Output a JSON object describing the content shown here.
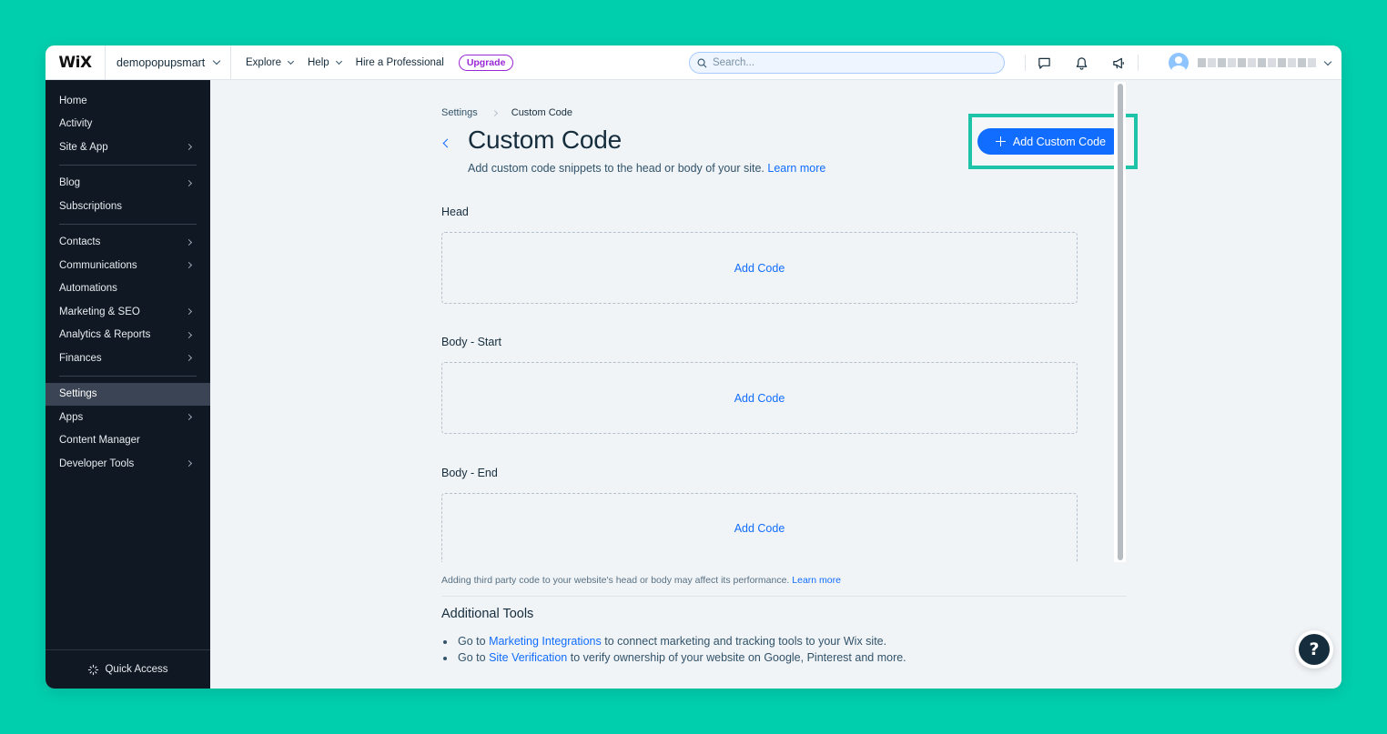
{
  "topbar": {
    "logo": "WiX",
    "site_name": "demopopupsmart",
    "nav": [
      {
        "label": "Explore"
      },
      {
        "label": "Help"
      },
      {
        "label": "Hire a Professional"
      }
    ],
    "upgrade_label": "Upgrade",
    "search_placeholder": "Search..."
  },
  "sidebar": {
    "items": [
      {
        "label": "Home"
      },
      {
        "label": "Activity"
      },
      {
        "label": "Site & App"
      },
      {
        "label": "Blog"
      },
      {
        "label": "Subscriptions"
      },
      {
        "label": "Contacts"
      },
      {
        "label": "Communications"
      },
      {
        "label": "Automations"
      },
      {
        "label": "Marketing & SEO"
      },
      {
        "label": "Analytics & Reports"
      },
      {
        "label": "Finances"
      },
      {
        "label": "Settings"
      },
      {
        "label": "Apps"
      },
      {
        "label": "Content Manager"
      },
      {
        "label": "Developer Tools"
      }
    ],
    "quick_access": "Quick Access"
  },
  "main": {
    "breadcrumb": [
      "Settings",
      "Custom Code"
    ],
    "title": "Custom Code",
    "subtitle": "Add custom code snippets to the head or body of your site.",
    "learn_more": "Learn more",
    "add_button": "Add Custom Code",
    "sections": [
      {
        "label": "Head",
        "action": "Add Code"
      },
      {
        "label": "Body - Start",
        "action": "Add Code"
      },
      {
        "label": "Body - End",
        "action": "Add Code"
      }
    ],
    "note": "Adding third party code to your website's head or body may affect its performance.",
    "note_link": "Learn more",
    "tools": {
      "title": "Additional Tools",
      "items": [
        {
          "prefix": "Go to",
          "link": "Marketing Integrations",
          "suffix": "to connect marketing and tracking tools to your Wix site."
        },
        {
          "prefix": "Go to",
          "link": "Site Verification",
          "suffix": "to verify ownership of your website on Google, Pinterest and more."
        }
      ]
    }
  },
  "colors": {
    "background": "#00cfae",
    "sidebar": "#101823",
    "accent": "#116dff",
    "highlight": "#1ec4a8",
    "upgrade": "#9a27d5"
  },
  "help_label": "?"
}
